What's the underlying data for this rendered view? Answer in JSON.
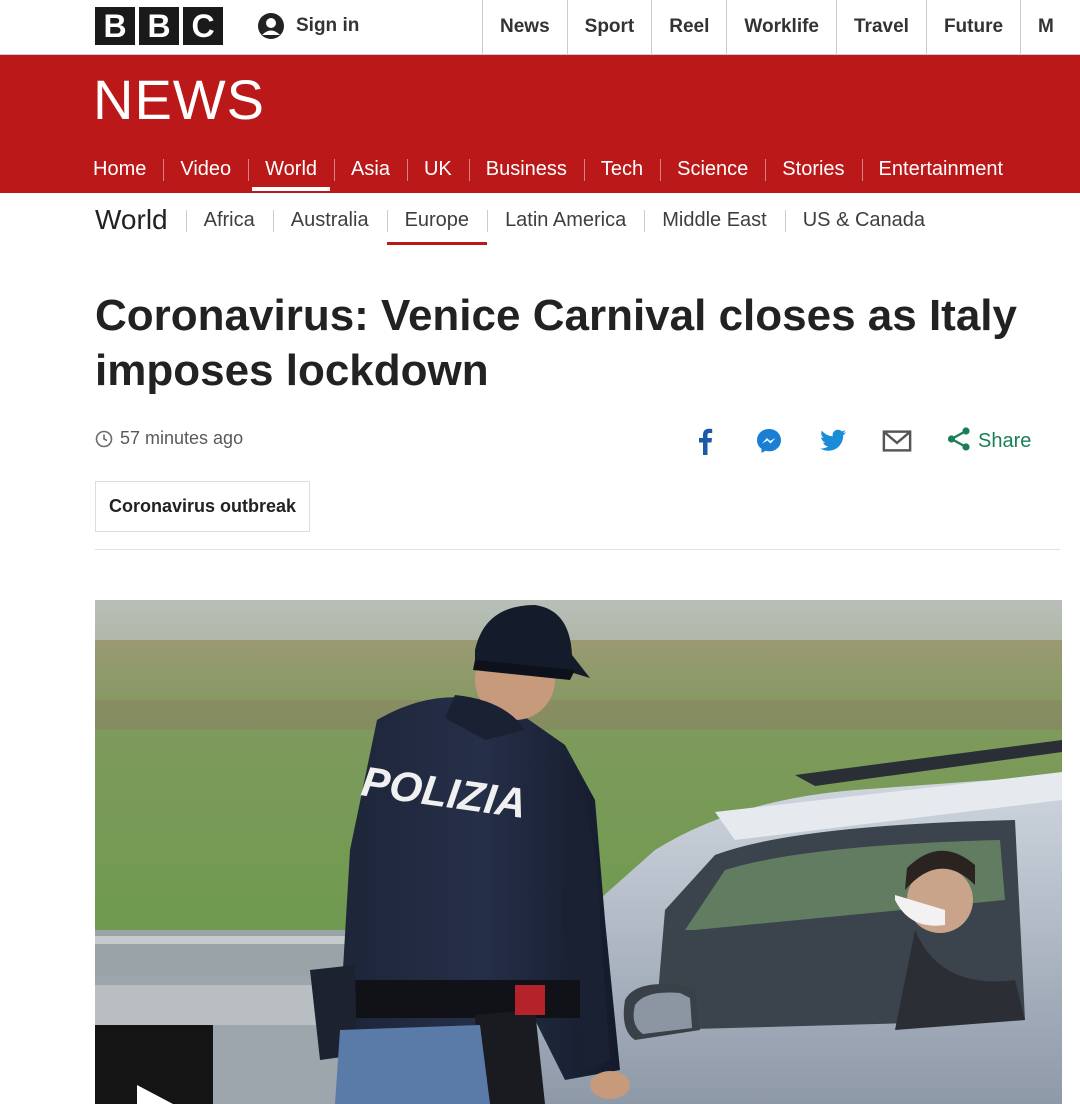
{
  "topbar": {
    "logo_letters": [
      "B",
      "B",
      "C"
    ],
    "sign_in": "Sign in",
    "nav": [
      "News",
      "Sport",
      "Reel",
      "Worklife",
      "Travel",
      "Future",
      "M"
    ]
  },
  "banner": {
    "title": "NEWS",
    "nav": [
      "Home",
      "Video",
      "World",
      "Asia",
      "UK",
      "Business",
      "Tech",
      "Science",
      "Stories",
      "Entertainment"
    ],
    "active": "World",
    "color": "#bb1919"
  },
  "subnav": {
    "section": "World",
    "items": [
      "Africa",
      "Australia",
      "Europe",
      "Latin America",
      "Middle East",
      "US & Canada"
    ],
    "active": "Europe"
  },
  "article": {
    "headline": "Coronavirus: Venice Carnival closes as Italy imposes lockdown",
    "timestamp": "57 minutes ago",
    "share_label": "Share",
    "share_icons": [
      "facebook-icon",
      "messenger-icon",
      "twitter-icon",
      "email-icon",
      "share-icon"
    ],
    "tag": "Coronavirus outbreak",
    "hero_vest_text": "POLIZIA"
  }
}
